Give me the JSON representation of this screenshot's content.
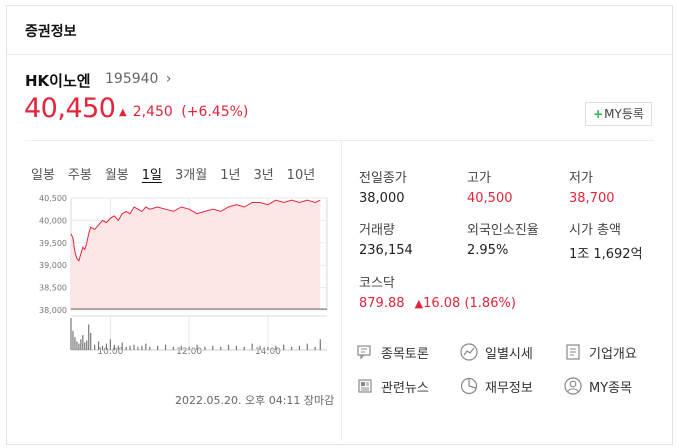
{
  "header": {
    "title": "증권정보"
  },
  "stock": {
    "name": "HK이노엔",
    "code": "195940",
    "code_chevron": "›",
    "price": "40,450",
    "change_arrow": "▲",
    "change_amount": "2,450",
    "change_percent": "(+6.45%)",
    "my_button_plus": "+",
    "my_button_label": "MY등록"
  },
  "periods": [
    "일봉",
    "주봉",
    "월봉",
    "1일",
    "3개월",
    "1년",
    "3년",
    "10년"
  ],
  "active_period": "1일",
  "chart_data": {
    "type": "area",
    "y_ticks": [
      "40,500",
      "40,000",
      "39,500",
      "39,000",
      "38,500",
      "38,000"
    ],
    "y_tick_values": [
      40500,
      40000,
      39500,
      39000,
      38500,
      38000
    ],
    "x_ticks": [
      "10:00",
      "12:00",
      "14:00"
    ],
    "x_tick_values": [
      10,
      12,
      14
    ],
    "xlim": [
      9,
      15.5
    ],
    "ylim": [
      38000,
      40500
    ],
    "prev_close": 38000,
    "x": [
      9.0,
      9.05,
      9.1,
      9.15,
      9.2,
      9.25,
      9.3,
      9.35,
      9.4,
      9.45,
      9.5,
      9.6,
      9.7,
      9.8,
      9.9,
      10.0,
      10.1,
      10.2,
      10.3,
      10.4,
      10.5,
      10.6,
      10.7,
      10.8,
      10.9,
      11.0,
      11.2,
      11.4,
      11.6,
      11.8,
      12.0,
      12.2,
      12.4,
      12.6,
      12.8,
      13.0,
      13.2,
      13.4,
      13.6,
      13.8,
      14.0,
      14.2,
      14.4,
      14.6,
      14.8,
      15.0,
      15.2,
      15.33
    ],
    "y": [
      39700,
      39600,
      39300,
      39150,
      39100,
      39250,
      39400,
      39350,
      39500,
      39700,
      39850,
      39800,
      39900,
      40000,
      39950,
      40050,
      40100,
      40000,
      40150,
      40200,
      40150,
      40300,
      40250,
      40200,
      40300,
      40250,
      40300,
      40250,
      40200,
      40300,
      40250,
      40150,
      40200,
      40250,
      40200,
      40300,
      40350,
      40300,
      40400,
      40400,
      40350,
      40450,
      40400,
      40450,
      40400,
      40450,
      40400,
      40450
    ],
    "volume": [
      30,
      18,
      12,
      8,
      6,
      10,
      14,
      7,
      9,
      24,
      16,
      5,
      8,
      4,
      6,
      10,
      5,
      4,
      7,
      3,
      4,
      5,
      3,
      4,
      6,
      3,
      4,
      5,
      3,
      4,
      3,
      5,
      3,
      4,
      3,
      5,
      4,
      3,
      6,
      4,
      3,
      4,
      5,
      3,
      4,
      6,
      3,
      10
    ],
    "colors": {
      "line": "#e5243b",
      "fill": "#fde6e6"
    }
  },
  "timestamp": "2022.05.20. 오후 04:11 장마감",
  "stats": [
    {
      "label": "전일종가",
      "value": "38,000",
      "red": false
    },
    {
      "label": "고가",
      "value": "40,500",
      "red": true
    },
    {
      "label": "저가",
      "value": "38,700",
      "red": true
    },
    {
      "label": "거래량",
      "value": "236,154",
      "red": false
    },
    {
      "label": "외국인소진율",
      "value": "2.95%",
      "red": false
    },
    {
      "label": "시가 총액",
      "value": "1조 1,692억",
      "red": false
    }
  ],
  "index": {
    "label": "코스닥",
    "value": "879.88",
    "arrow": "▲",
    "change": "16.08 (1.86%)"
  },
  "links": [
    {
      "label": "종목토론",
      "icon": "chat-icon"
    },
    {
      "label": "일별시세",
      "icon": "trend-icon"
    },
    {
      "label": "기업개요",
      "icon": "document-icon"
    },
    {
      "label": "관련뉴스",
      "icon": "news-icon"
    },
    {
      "label": "재무정보",
      "icon": "pie-icon"
    },
    {
      "label": "MY종목",
      "icon": "person-icon"
    }
  ]
}
